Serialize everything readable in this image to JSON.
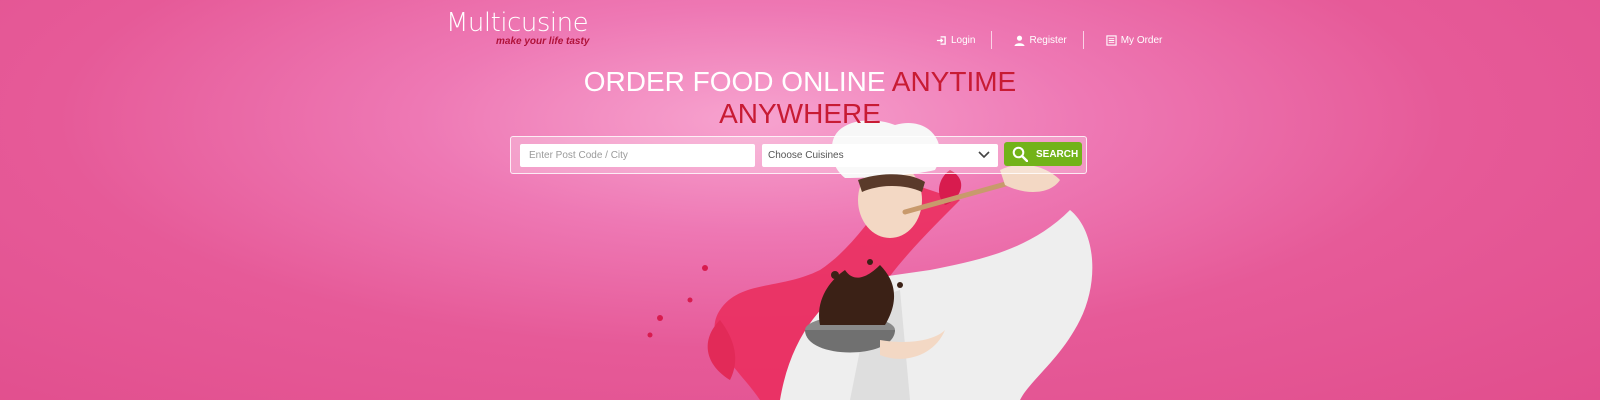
{
  "header": {
    "logo_title": "Multicusine",
    "logo_tagline": "make your life tasty",
    "nav": [
      {
        "label": "Login",
        "icon": "login-icon"
      },
      {
        "label": "Register",
        "icon": "user-icon"
      },
      {
        "label": "My Order",
        "icon": "order-list-icon"
      }
    ]
  },
  "hero": {
    "title_main": "ORDER FOOD ONLINE",
    "title_accent_1": "ANYTIME",
    "title_accent_2": "ANYWHERE"
  },
  "search": {
    "postcode_placeholder": "Enter Post Code / City",
    "cuisine_selected": "Choose Cuisines",
    "button_label": "SEARCH"
  },
  "colors": {
    "background": "#e65a98",
    "accent_red": "#c81b34",
    "search_green": "#72b319"
  }
}
